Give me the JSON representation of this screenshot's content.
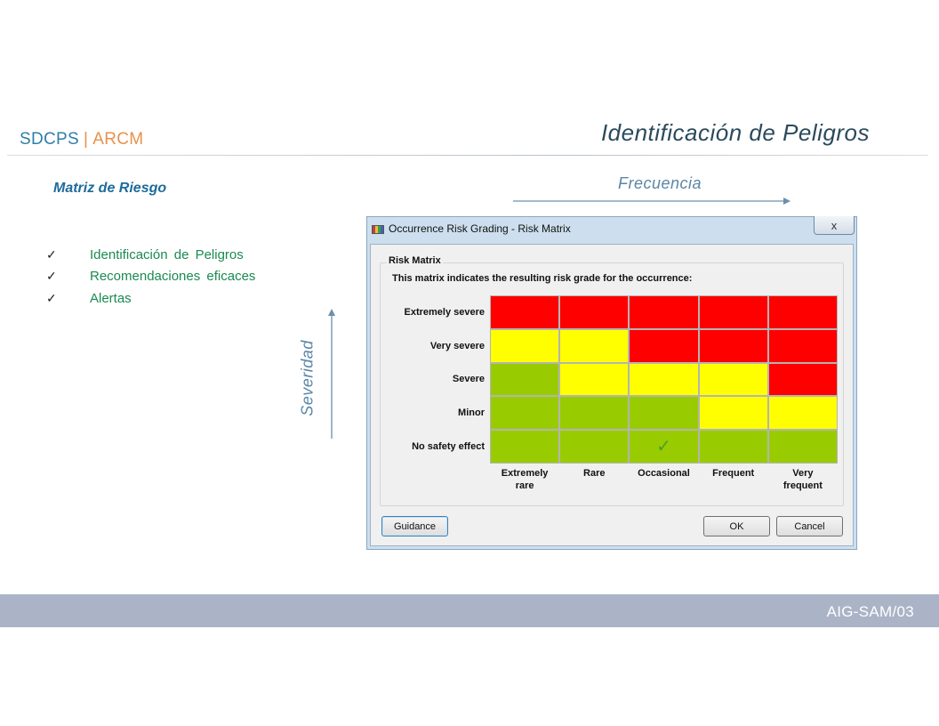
{
  "header": {
    "brand_primary": "SDCPS",
    "brand_separator": "|",
    "brand_secondary": "ARCM",
    "title": "Identificación de Peligros"
  },
  "subtitle": "Matriz de Riesgo",
  "checklist": [
    {
      "icon": "check-icon",
      "label": "Identificación  de Peligros"
    },
    {
      "icon": "check-icon",
      "label": "Recomendaciones  eficaces"
    },
    {
      "icon": "check-icon",
      "label": "Alertas"
    }
  ],
  "axes": {
    "x_label": "Frecuencia",
    "y_label": "Severidad"
  },
  "dialog": {
    "title": "Occurrence Risk Grading - Risk Matrix",
    "close_label": "x",
    "group_caption": "Risk Matrix",
    "intro": "This matrix indicates the resulting risk grade for the occurrence:",
    "rows": [
      "Extremely severe",
      "Very severe",
      "Severe",
      "Minor",
      "No safety effect"
    ],
    "columns": [
      "Extremely\nrare",
      "Rare",
      "Occasional",
      "Frequent",
      "Very\nfrequent"
    ],
    "grid": [
      [
        "red",
        "red",
        "red",
        "red",
        "red"
      ],
      [
        "yellow",
        "yellow",
        "red",
        "red",
        "red"
      ],
      [
        "green",
        "yellow",
        "yellow",
        "yellow",
        "red"
      ],
      [
        "green",
        "green",
        "green",
        "yellow",
        "yellow"
      ],
      [
        "green",
        "green",
        "green",
        "green",
        "green"
      ]
    ],
    "selected": {
      "row": "No safety effect",
      "column": "Occasional"
    },
    "colors": {
      "red": "#ff0000",
      "yellow": "#ffff00",
      "green": "#99cc00"
    },
    "buttons": {
      "guidance": "Guidance",
      "ok": "OK",
      "cancel": "Cancel"
    }
  },
  "footer": {
    "code": "AIG-SAM/03"
  }
}
